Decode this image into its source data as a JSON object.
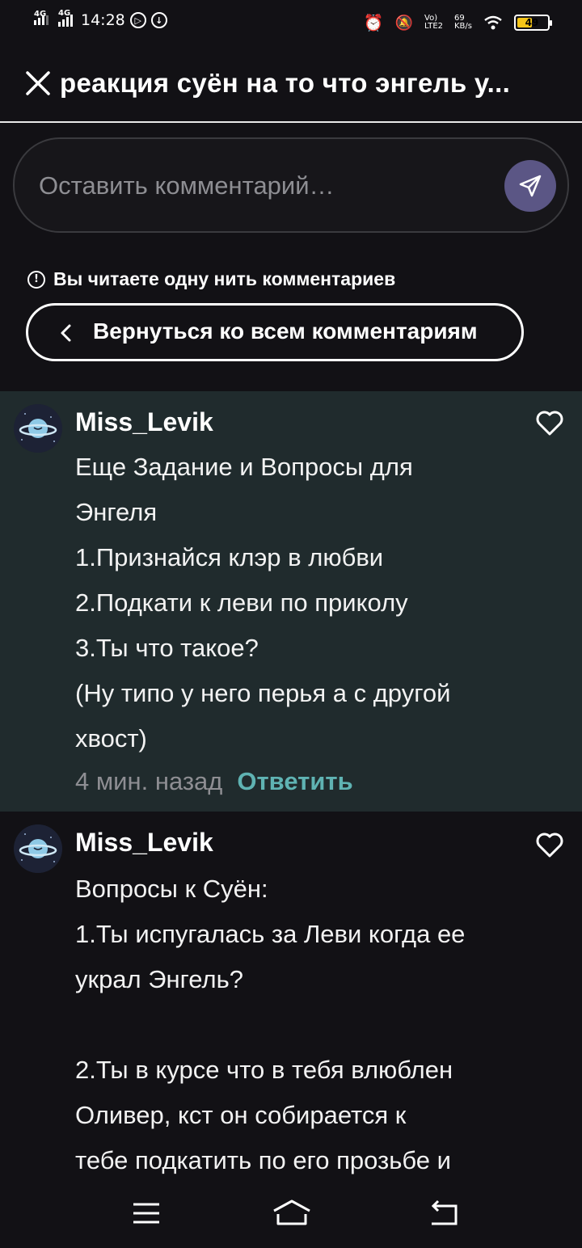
{
  "status_bar": {
    "net1": "4G",
    "net2": "4G",
    "time": "14:28",
    "battery": "49",
    "battery_level": 0.49
  },
  "header": {
    "title": "реакция суён на то что энгель у..."
  },
  "comment_input": {
    "placeholder": "Оставить комментарий…"
  },
  "thread_notice": "Вы читаете одну нить комментариев",
  "back_button": "Вернуться ко всем комментариям",
  "comments": [
    {
      "user": "Miss_Levik",
      "lines": [
        "Еще Задание и Вопросы для",
        "Энгеля",
        "1.Признайся клэр в любви",
        "2.Подкати к леви по приколу",
        "3.Ты что такое?",
        "(Ну типо у него перья а с другой",
        "хвост)"
      ],
      "time": "4 мин. назад",
      "reply": "Ответить"
    },
    {
      "user": "Miss_Levik",
      "lines": [
        "Вопросы к Суён:",
        "1.Ты испугалась за Леви когда ее",
        "украл Энгель?",
        "",
        "2.Ты в курсе что в тебя влюблен",
        "Оливер, кст он собирается к",
        "тебе подкатить по его прозьбе и"
      ]
    }
  ],
  "colors": {
    "background": "#121115",
    "highlight": "#202b2d",
    "accent": "#5fb3b3",
    "send": "#5b5685"
  }
}
